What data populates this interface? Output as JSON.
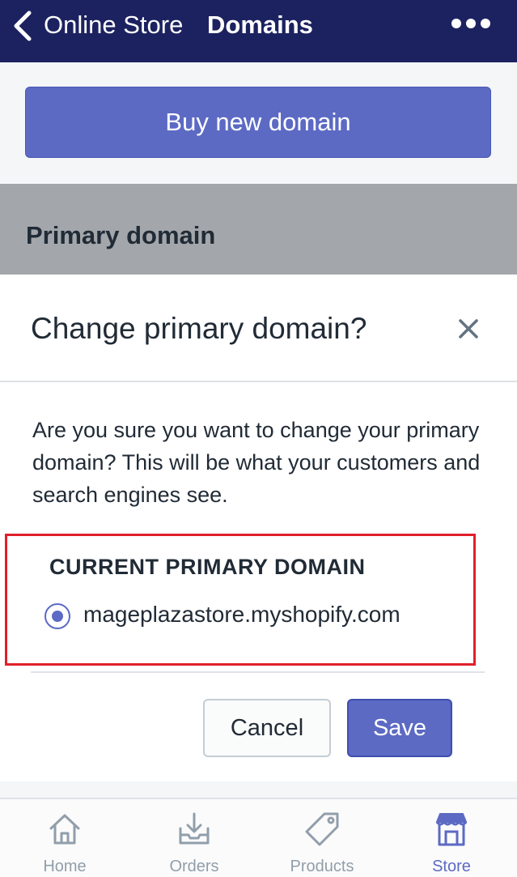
{
  "header": {
    "back_label": "Online Store",
    "title": "Domains"
  },
  "buy_button_label": "Buy new domain",
  "section_heading": "Primary domain",
  "modal": {
    "title": "Change primary domain?",
    "body": "Are you sure you want to change your primary domain? This will be what your customers and search engines see.",
    "section_label": "CURRENT PRIMARY DOMAIN",
    "domain_option": "mageplazastore.myshopify.com",
    "cancel_label": "Cancel",
    "save_label": "Save"
  },
  "tabs": [
    {
      "label": "Home",
      "icon": "home-icon",
      "active": false
    },
    {
      "label": "Orders",
      "icon": "orders-icon",
      "active": false
    },
    {
      "label": "Products",
      "icon": "tag-icon",
      "active": false
    },
    {
      "label": "Store",
      "icon": "store-icon",
      "active": true
    }
  ],
  "colors": {
    "topbar": "#1c2260",
    "accent": "#5c6ac4",
    "highlight_border": "#e0202a",
    "tab_inactive": "#919eab"
  }
}
